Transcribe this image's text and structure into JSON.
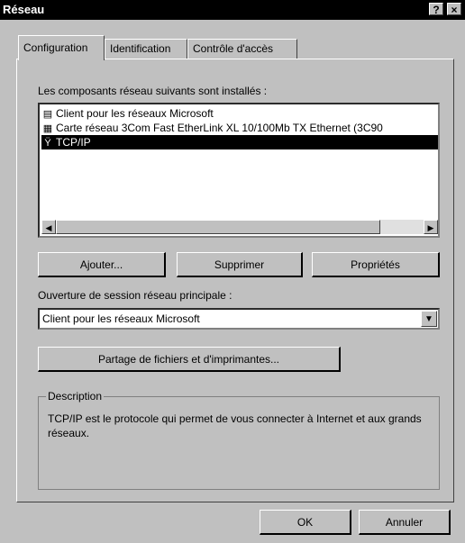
{
  "window": {
    "title": "Réseau",
    "help_label": "?",
    "close_label": "×"
  },
  "tabs": [
    {
      "label": "Configuration"
    },
    {
      "label": "Identification"
    },
    {
      "label": "Contrôle d'accès"
    }
  ],
  "components": {
    "label": "Les composants réseau suivants sont installés :",
    "items": [
      {
        "label": "Client pour les réseaux Microsoft",
        "icon": "network-client-icon",
        "selected": false
      },
      {
        "label": "Carte réseau 3Com Fast EtherLink XL 10/100Mb TX Ethernet (3C90",
        "icon": "network-card-icon",
        "selected": false
      },
      {
        "label": "TCP/IP",
        "icon": "protocol-icon",
        "selected": true
      }
    ]
  },
  "buttons": {
    "add": "Ajouter...",
    "remove": "Supprimer",
    "properties": "Propriétés"
  },
  "logon": {
    "label": "Ouverture de session réseau principale :",
    "value": "Client pour les réseaux Microsoft"
  },
  "sharing_button": "Partage de fichiers et d'imprimantes...",
  "description": {
    "title": "Description",
    "text": "TCP/IP est le protocole qui permet de vous connecter à Internet et aux grands réseaux."
  },
  "footer": {
    "ok": "OK",
    "cancel": "Annuler"
  }
}
